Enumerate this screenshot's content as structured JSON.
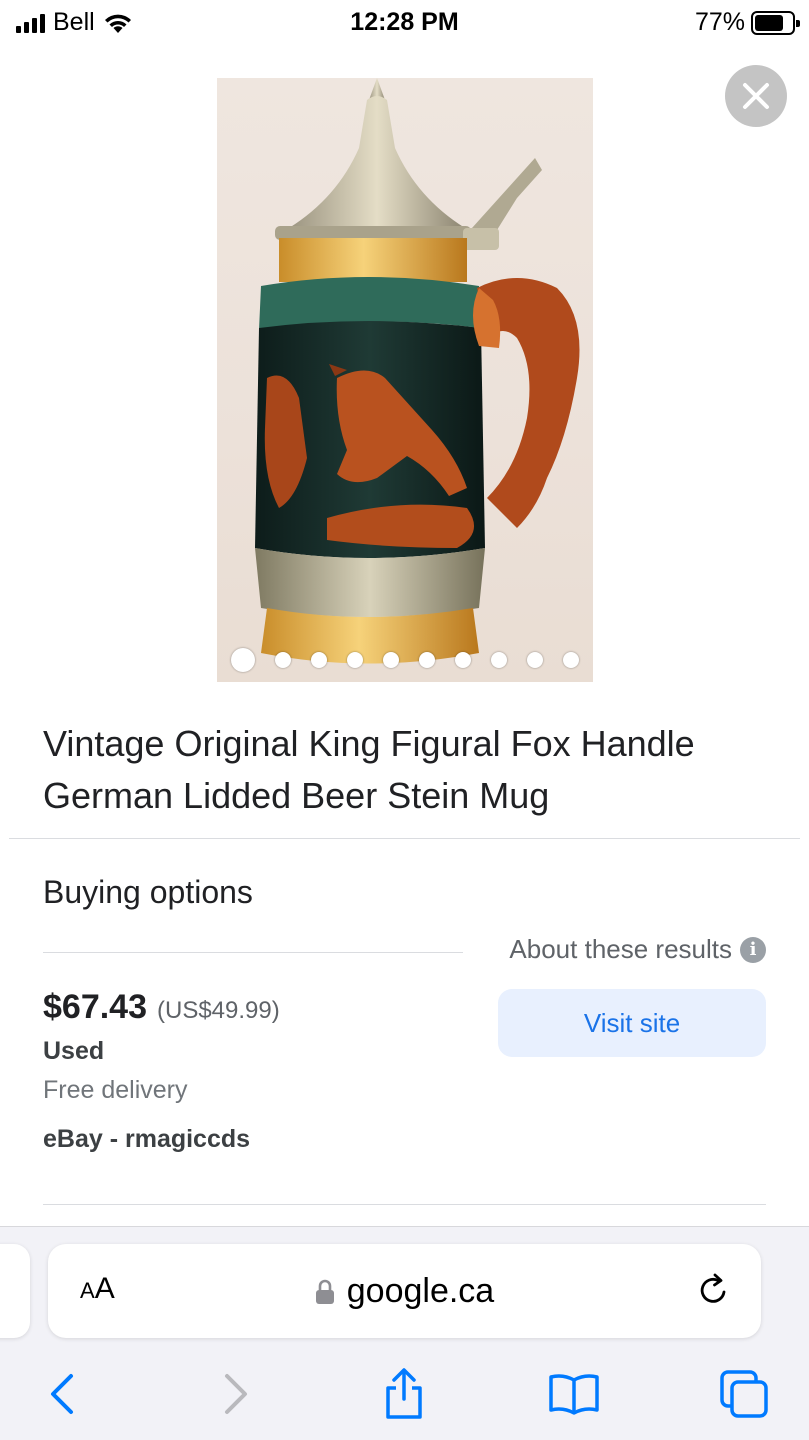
{
  "status_bar": {
    "carrier": "Bell",
    "time": "12:28 PM",
    "battery": "77%",
    "battery_level": 0.77
  },
  "product": {
    "image_icon": "beer-stein-photo",
    "image_count": 10,
    "active_image_index": 0,
    "title": "Vintage Original King Figural Fox Handle German Lidded Beer Stein Mug"
  },
  "buying_options": {
    "heading": "Buying options",
    "about": "About these results",
    "offer": {
      "price": "$67.43",
      "price_usd": "(US$49.99)",
      "condition": "Used",
      "delivery": "Free delivery",
      "seller": "eBay - rmagiccds",
      "visit_label": "Visit site"
    }
  },
  "browser": {
    "aa_small": "A",
    "aa_large": "A",
    "domain": "google.ca",
    "accent_color": "#1a73e8",
    "toolbar_color": "#007aff",
    "icons": [
      "back-icon",
      "forward-icon",
      "share-icon",
      "bookmarks-icon",
      "tabs-icon"
    ]
  }
}
